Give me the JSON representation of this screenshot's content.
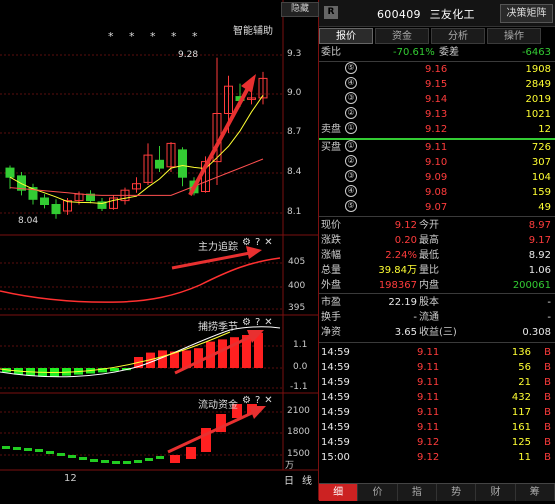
{
  "chart": {
    "hide_button": "隐藏",
    "smart_assist": "智能辅助",
    "stars": "* * * *  *",
    "high_label": "9.28",
    "low_label": "8.04",
    "price_ticks": [
      "9.3",
      "9.0",
      "8.7",
      "8.4",
      "8.1"
    ],
    "ind1_title": "主力追踪",
    "ind1_ticks": [
      "405",
      "400",
      "395"
    ],
    "ind2_title": "捕捞季节",
    "ind2_ticks": [
      "1.1",
      "0.0",
      "-1.1"
    ],
    "ind3_title": "流动资金",
    "ind3_ticks": [
      "2100",
      "1800",
      "1500"
    ],
    "ind3_unit": "万",
    "x_label": "12",
    "day_button": "日",
    "line_button": "线"
  },
  "header": {
    "badge": "R",
    "code": "600409",
    "name": "三友化工",
    "decision": "决策矩阵"
  },
  "tabs": [
    "报价",
    "资金",
    "分析",
    "操作"
  ],
  "weibi": {
    "label1": "委比",
    "val1": "-70.61%",
    "label2": "委差",
    "val2": "-6463"
  },
  "sell": [
    {
      "n": "⑤",
      "price": "9.16",
      "vol": "1908"
    },
    {
      "n": "④",
      "price": "9.15",
      "vol": "2849"
    },
    {
      "n": "③",
      "price": "9.14",
      "vol": "2019"
    },
    {
      "n": "②",
      "price": "9.13",
      "vol": "1021"
    },
    {
      "n": "①",
      "price": "9.12",
      "vol": "12"
    }
  ],
  "sell_label": "卖盘",
  "buy_label": "买盘",
  "buy": [
    {
      "n": "①",
      "price": "9.11",
      "vol": "726"
    },
    {
      "n": "②",
      "price": "9.10",
      "vol": "307"
    },
    {
      "n": "③",
      "price": "9.09",
      "vol": "104"
    },
    {
      "n": "④",
      "price": "9.08",
      "vol": "159"
    },
    {
      "n": "⑤",
      "price": "9.07",
      "vol": "49"
    }
  ],
  "stats": [
    {
      "k1": "现价",
      "v1": "9.12",
      "k2": "今开",
      "v2": "8.97"
    },
    {
      "k1": "涨跌",
      "v1": "0.20",
      "k2": "最高",
      "v2": "9.17"
    },
    {
      "k1": "涨幅",
      "v1": "2.24%",
      "k2": "最低",
      "v2": "8.92"
    },
    {
      "k1": "总量",
      "v1": "39.84万",
      "k2": "量比",
      "v2": "1.06"
    },
    {
      "k1": "外盘",
      "v1": "198367",
      "k2": "内盘",
      "v2": "200061"
    }
  ],
  "fund": [
    {
      "k1": "市盈",
      "v1": "22.19",
      "k2": "股本",
      "v2": "-"
    },
    {
      "k1": "换手",
      "v1": "-",
      "k2": "流通",
      "v2": "-"
    },
    {
      "k1": "净资",
      "v1": "3.65",
      "k2": "收益(三)",
      "v2": "0.308"
    }
  ],
  "ticks": [
    {
      "t": "14:59",
      "p": "9.11",
      "v": "136",
      "d": "B"
    },
    {
      "t": "14:59",
      "p": "9.11",
      "v": "56",
      "d": "B"
    },
    {
      "t": "14:59",
      "p": "9.11",
      "v": "21",
      "d": "B"
    },
    {
      "t": "14:59",
      "p": "9.11",
      "v": "432",
      "d": "B"
    },
    {
      "t": "14:59",
      "p": "9.11",
      "v": "117",
      "d": "B"
    },
    {
      "t": "14:59",
      "p": "9.11",
      "v": "161",
      "d": "B"
    },
    {
      "t": "14:59",
      "p": "9.12",
      "v": "125",
      "d": "B"
    },
    {
      "t": "15:00",
      "p": "9.12",
      "v": "11",
      "d": "B"
    }
  ],
  "bottom_tabs": [
    "细",
    "价",
    "指",
    "势",
    "财",
    "筹"
  ],
  "colors": {
    "up": "#ff3c3c",
    "down": "#33cc33",
    "ma1": "#ffff33",
    "ma2": "#cc66ff",
    "ma3": "#33ff33"
  }
}
